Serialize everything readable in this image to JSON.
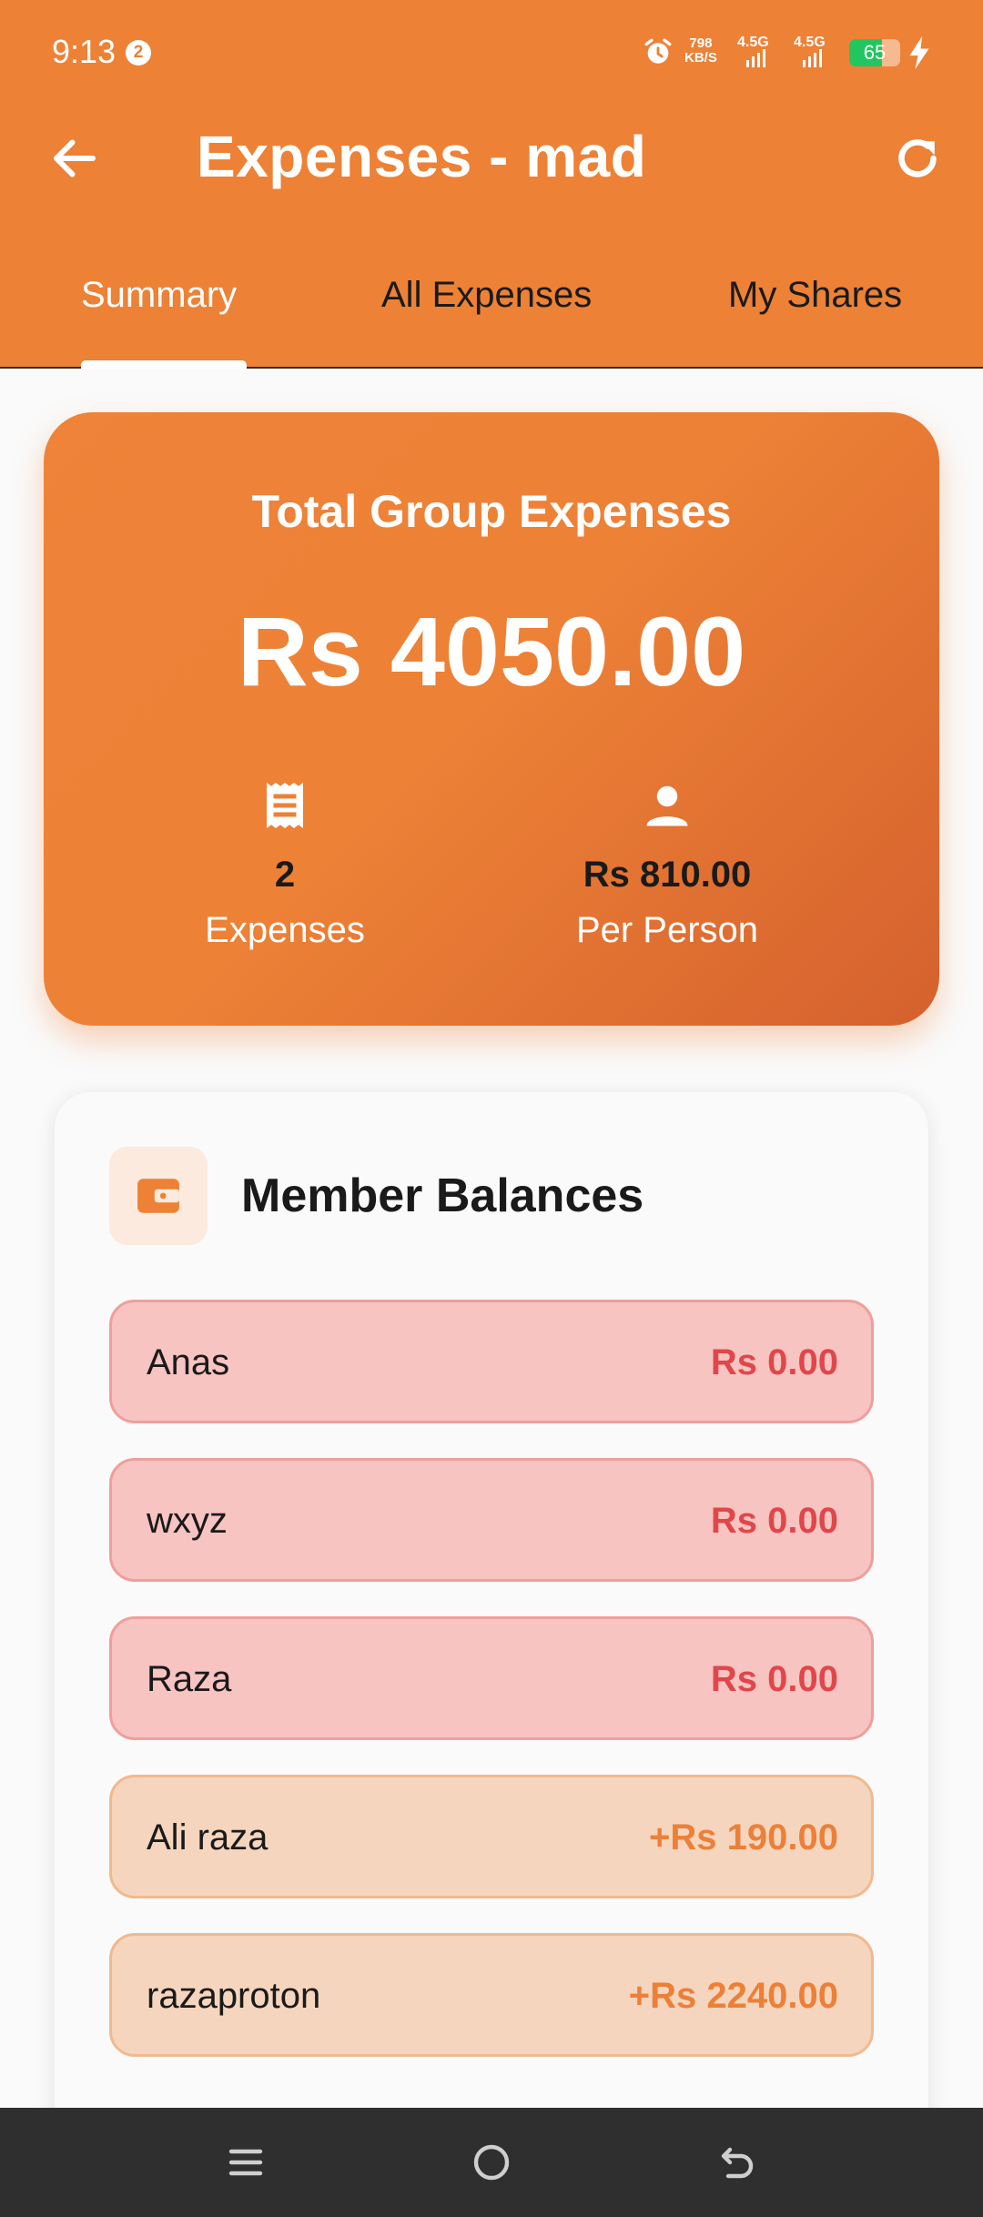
{
  "status_bar": {
    "time": "9:13",
    "notification_count": "2",
    "net_speed_value": "798",
    "net_speed_unit": "KB/S",
    "network_1": "4.5G",
    "network_2": "4.5G",
    "battery_level": 65,
    "battery_text": "65"
  },
  "header": {
    "title": "Expenses - mad"
  },
  "tabs": [
    {
      "label": "Summary",
      "active": true
    },
    {
      "label": "All Expenses",
      "active": false
    },
    {
      "label": "My Shares",
      "active": false
    }
  ],
  "summary": {
    "title": "Total Group Expenses",
    "amount": "Rs 4050.00",
    "expenses_count": "2",
    "expenses_label": "Expenses",
    "per_person_value": "Rs 810.00",
    "per_person_label": "Per Person"
  },
  "balances": {
    "title": "Member Balances",
    "members": [
      {
        "name": "Anas",
        "amount": "Rs 0.00",
        "kind": "neg"
      },
      {
        "name": "wxyz",
        "amount": "Rs 0.00",
        "kind": "neg"
      },
      {
        "name": "Raza",
        "amount": "Rs 0.00",
        "kind": "neg"
      },
      {
        "name": "Ali raza",
        "amount": "+Rs 190.00",
        "kind": "pos"
      },
      {
        "name": "razaproton",
        "amount": "+Rs 2240.00",
        "kind": "pos"
      }
    ]
  },
  "icons": {
    "back": "arrow-left-icon",
    "refresh": "refresh-icon",
    "receipt": "receipt-icon",
    "person": "person-icon",
    "wallet": "wallet-icon",
    "nav_menu": "menu-icon",
    "nav_home": "home-circle-icon",
    "nav_back": "back-icon"
  },
  "colors": {
    "primary": "#ed8136",
    "negative_text": "#e0474a",
    "negative_bg": "#f7c4c2",
    "positive_text": "#ec8038",
    "positive_bg": "#f5d5bd"
  }
}
